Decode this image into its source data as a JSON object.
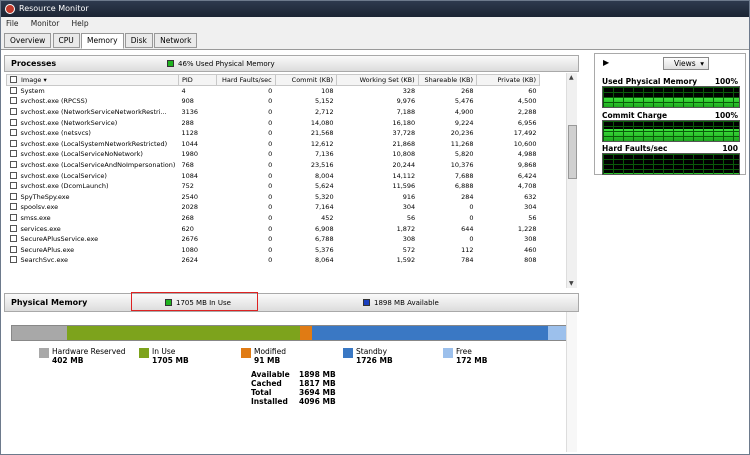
{
  "window": {
    "title": "Resource Monitor"
  },
  "menu": [
    "File",
    "Monitor",
    "Help"
  ],
  "tabs": [
    "Overview",
    "CPU",
    "Memory",
    "Disk",
    "Network"
  ],
  "processes": {
    "title": "Processes",
    "summary": "46% Used Physical Memory",
    "columns": [
      "Image",
      "PID",
      "Hard Faults/sec",
      "Commit (KB)",
      "Working Set (KB)",
      "Shareable (KB)",
      "Private (KB)"
    ],
    "rows": [
      [
        "System",
        "4",
        "0",
        "108",
        "328",
        "268",
        "60"
      ],
      [
        "svchost.exe (RPCSS)",
        "908",
        "0",
        "5,152",
        "9,976",
        "5,476",
        "4,500"
      ],
      [
        "svchost.exe (NetworkServiceNetworkRestri...",
        "3136",
        "0",
        "2,712",
        "7,188",
        "4,900",
        "2,288"
      ],
      [
        "svchost.exe (NetworkService)",
        "288",
        "0",
        "14,080",
        "16,180",
        "9,224",
        "6,956"
      ],
      [
        "svchost.exe (netsvcs)",
        "1128",
        "0",
        "21,568",
        "37,728",
        "20,236",
        "17,492"
      ],
      [
        "svchost.exe (LocalSystemNetworkRestricted)",
        "1044",
        "0",
        "12,612",
        "21,868",
        "11,268",
        "10,600"
      ],
      [
        "svchost.exe (LocalServiceNoNetwork)",
        "1980",
        "0",
        "7,136",
        "10,808",
        "5,820",
        "4,988"
      ],
      [
        "svchost.exe (LocalServiceAndNoImpersonation)",
        "768",
        "0",
        "23,516",
        "20,244",
        "10,376",
        "9,868"
      ],
      [
        "svchost.exe (LocalService)",
        "1084",
        "0",
        "8,004",
        "14,112",
        "7,688",
        "6,424"
      ],
      [
        "svchost.exe (DcomLaunch)",
        "752",
        "0",
        "5,624",
        "11,596",
        "6,888",
        "4,708"
      ],
      [
        "SpyTheSpy.exe",
        "2540",
        "0",
        "5,320",
        "916",
        "284",
        "632"
      ],
      [
        "spoolsv.exe",
        "2028",
        "0",
        "7,164",
        "304",
        "0",
        "304"
      ],
      [
        "smss.exe",
        "268",
        "0",
        "452",
        "56",
        "0",
        "56"
      ],
      [
        "services.exe",
        "620",
        "0",
        "6,908",
        "1,872",
        "644",
        "1,228"
      ],
      [
        "SecureAPlusService.exe",
        "2676",
        "0",
        "6,788",
        "308",
        "0",
        "308"
      ],
      [
        "SecureAPlus.exe",
        "1080",
        "0",
        "5,376",
        "572",
        "112",
        "460"
      ],
      [
        "SearchSvc.exe",
        "2624",
        "0",
        "8,064",
        "1,592",
        "784",
        "808"
      ]
    ]
  },
  "physical_memory": {
    "title": "Physical Memory",
    "in_use_header": "1705 MB In Use",
    "available_header": "1898 MB Available",
    "bar": [
      {
        "name": "Hardware Reserved",
        "mb": 402,
        "color": "#a8a8a8"
      },
      {
        "name": "In Use",
        "mb": 1705,
        "color": "#7da31c"
      },
      {
        "name": "Modified",
        "mb": 91,
        "color": "#e07b14"
      },
      {
        "name": "Standby",
        "mb": 1726,
        "color": "#3a78c4"
      },
      {
        "name": "Free",
        "mb": 172,
        "color": "#9cc0ec"
      }
    ],
    "legend": [
      {
        "label": "Hardware Reserved",
        "value": "402 MB",
        "color": "#a8a8a8"
      },
      {
        "label": "In Use",
        "value": "1705 MB",
        "color": "#7da31c"
      },
      {
        "label": "Modified",
        "value": "91 MB",
        "color": "#e07b14"
      },
      {
        "label": "Standby",
        "value": "1726 MB",
        "color": "#3a78c4"
      },
      {
        "label": "Free",
        "value": "172 MB",
        "color": "#9cc0ec"
      }
    ],
    "stats": [
      [
        "Available",
        "1898 MB"
      ],
      [
        "Cached",
        "1817 MB"
      ],
      [
        "Total",
        "3694 MB"
      ],
      [
        "Installed",
        "4096 MB"
      ]
    ]
  },
  "graphs": {
    "views_label": "Views",
    "items": [
      {
        "title": "Used Physical Memory",
        "pct": "100%",
        "level": 0.46
      },
      {
        "title": "Commit Charge",
        "pct": "100%",
        "level": 0.62
      },
      {
        "title": "Hard Faults/sec",
        "pct": "100",
        "level": 0.05
      }
    ]
  }
}
